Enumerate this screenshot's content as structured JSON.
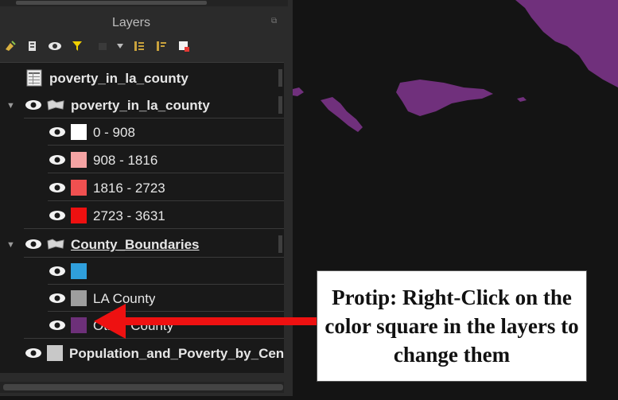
{
  "panel": {
    "title": "Layers",
    "toolbar_icons": [
      "style-manager-icon",
      "add-group-icon",
      "visibility-icon",
      "filter-icon",
      "legend-icon",
      "dropdown-icon",
      "expand-all-icon",
      "collapse-all-icon",
      "remove-layer-icon"
    ]
  },
  "layers": [
    {
      "name": "poverty_in_la_county",
      "type": "table"
    },
    {
      "name": "poverty_in_la_county",
      "type": "polygon",
      "expanded": true,
      "classes": [
        {
          "label": "0 - 908",
          "color": "#ffffff"
        },
        {
          "label": "908 - 1816",
          "color": "#f4a3a3"
        },
        {
          "label": "1816 - 2723",
          "color": "#f05050"
        },
        {
          "label": "2723 - 3631",
          "color": "#ee1010"
        }
      ]
    },
    {
      "name": "County_Boundaries",
      "type": "polygon",
      "expanded": true,
      "underlined": true,
      "classes": [
        {
          "label": "",
          "color": "#2f9fdc"
        },
        {
          "label": "LA County",
          "color": "#9e9e9e"
        },
        {
          "label": "Other County",
          "color": "#6d3079"
        }
      ]
    },
    {
      "name": "Population_and_Poverty_by_Cen",
      "type": "single",
      "color": "#c8c8c8"
    }
  ],
  "map": {
    "background": "#141414",
    "land_color": "#70307c"
  },
  "protip": {
    "text": "Protip: Right-Click on the color square in the layers to change them"
  },
  "annotation": {
    "arrow_color": "#ee1111"
  }
}
